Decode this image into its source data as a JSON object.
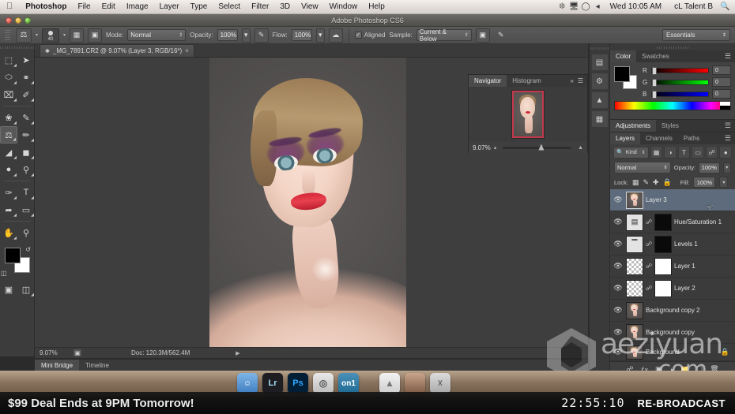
{
  "macbar": {
    "apple_icon": "apple-icon",
    "app_name": "Photoshop",
    "menus": [
      "File",
      "Edit",
      "Image",
      "Layer",
      "Type",
      "Select",
      "Filter",
      "3D",
      "View",
      "Window",
      "Help"
    ],
    "status_icons": [
      "bluetooth-icon",
      "display-icon",
      "wifi-icon",
      "volume-icon"
    ],
    "clock": "Wed 10:05 AM",
    "user": "cL Talent B",
    "search_icon": "search-icon"
  },
  "titlebar": {
    "title": "Adobe Photoshop CS6",
    "close": "close-button",
    "minimize": "minimize-button",
    "zoom": "zoom-button"
  },
  "options_bar": {
    "tool_icon": "clone-stamp-icon",
    "brush_size": "40",
    "brush_panel_icon": "brush-panel-icon",
    "clone_source_icon": "clone-source-icon",
    "mode_label": "Mode:",
    "mode_value": "Normal",
    "opacity_label": "Opacity:",
    "opacity_value": "100%",
    "pressure_opacity_icon": "pressure-opacity-icon",
    "flow_label": "Flow:",
    "flow_value": "100%",
    "airbrush_icon": "airbrush-icon",
    "aligned_label": "Aligned",
    "sample_label": "Sample:",
    "sample_value": "Current & Below",
    "ignore_adjustment_icon": "ignore-adjustment-layers-icon",
    "tablet_pressure_icon": "tablet-pressure-icon",
    "workspace": "Essentials"
  },
  "document": {
    "tab_title": "_MG_7891.CR2 @ 9.07% (Layer 3, RGB/16*)",
    "close_icon": "close-tab-icon",
    "status_zoom": "9.07%",
    "status_doc": "Doc: 120.3M/562.4M",
    "bottom_tabs": [
      {
        "label": "Mini Bridge",
        "active": true
      },
      {
        "label": "Timeline",
        "active": false
      }
    ]
  },
  "navigator": {
    "tabs": [
      {
        "label": "Navigator",
        "active": true
      },
      {
        "label": "Histogram",
        "active": false
      }
    ],
    "collapse_icon": "collapse-icon",
    "menu_icon": "panel-menu-icon",
    "zoom_value": "9.07%",
    "zoom_out_icon": "zoom-out-icon",
    "zoom_in_icon": "zoom-in-icon"
  },
  "icon_rail": [
    "history-icon",
    "actions-icon",
    "adjustments-icon",
    "properties-icon"
  ],
  "color_panel": {
    "tabs": [
      {
        "label": "Color",
        "active": true
      },
      {
        "label": "Swatches",
        "active": false
      }
    ],
    "menu_icon": "panel-menu-icon",
    "foreground": "#000000",
    "background": "#ffffff",
    "channels": [
      {
        "label": "R",
        "value": "0"
      },
      {
        "label": "G",
        "value": "0"
      },
      {
        "label": "B",
        "value": "0"
      }
    ]
  },
  "adjustments_panel": {
    "tabs": [
      {
        "label": "Adjustments",
        "active": true
      },
      {
        "label": "Styles",
        "active": false
      }
    ],
    "menu_icon": "panel-menu-icon"
  },
  "layers_panel": {
    "tabs": [
      {
        "label": "Layers",
        "active": true
      },
      {
        "label": "Channels",
        "active": false
      },
      {
        "label": "Paths",
        "active": false
      }
    ],
    "menu_icon": "panel-menu-icon",
    "filter_kind": "Kind",
    "filter_icons": [
      "filter-pixel-icon",
      "filter-adjustment-icon",
      "filter-type-icon",
      "filter-shape-icon",
      "filter-smart-icon",
      "filter-toggle-icon"
    ],
    "blend_mode": "Normal",
    "opacity_label": "Opacity:",
    "opacity_value": "100%",
    "lock_label": "Lock:",
    "lock_icons": [
      "lock-transparent-icon",
      "lock-image-icon",
      "lock-position-icon",
      "lock-all-icon"
    ],
    "fill_label": "Fill:",
    "fill_value": "100%",
    "layers": [
      {
        "name": "Layer 3",
        "type": "pixel",
        "thumb": "portrait",
        "selected": true,
        "visible": true,
        "mask": null
      },
      {
        "name": "Hue/Saturation 1",
        "type": "adjustment",
        "thumb": "hue-sat-icon",
        "selected": false,
        "visible": true,
        "mask": "black"
      },
      {
        "name": "Levels 1",
        "type": "adjustment",
        "thumb": "levels-icon",
        "selected": false,
        "visible": true,
        "mask": "black"
      },
      {
        "name": "Layer 1",
        "type": "pixel",
        "thumb": "checker",
        "selected": false,
        "visible": true,
        "mask": "white"
      },
      {
        "name": "Layer 2",
        "type": "pixel",
        "thumb": "checker",
        "selected": false,
        "visible": true,
        "mask": "white"
      },
      {
        "name": "Background copy 2",
        "type": "pixel",
        "thumb": "portrait",
        "selected": false,
        "visible": true,
        "mask": null
      },
      {
        "name": "Background copy",
        "type": "pixel",
        "thumb": "portrait",
        "selected": false,
        "visible": true,
        "mask": null
      },
      {
        "name": "Background",
        "type": "pixel",
        "thumb": "portrait",
        "selected": false,
        "visible": true,
        "mask": null
      }
    ],
    "footer_icons": [
      "link-layers-icon",
      "layer-style-icon",
      "add-mask-icon",
      "adjustment-layer-icon",
      "new-group-icon",
      "new-layer-icon",
      "delete-layer-icon"
    ]
  },
  "tools": [
    {
      "name": "marquee-tool",
      "glyph": "⬚",
      "selected": false
    },
    {
      "name": "move-tool",
      "glyph": "➤",
      "selected": false
    },
    {
      "name": "lasso-tool",
      "glyph": "⬭",
      "selected": false
    },
    {
      "name": "quick-selection-tool",
      "glyph": "✒",
      "selected": false
    },
    {
      "name": "crop-tool",
      "glyph": "⌗",
      "selected": false
    },
    {
      "name": "eyedropper-tool",
      "glyph": "✐",
      "selected": false
    },
    {
      "name": "spot-healing-tool",
      "glyph": "❀",
      "selected": false
    },
    {
      "name": "brush-tool",
      "glyph": "✒",
      "selected": false
    },
    {
      "name": "clone-stamp-tool",
      "glyph": "⚑",
      "selected": true
    },
    {
      "name": "history-brush-tool",
      "glyph": "✎",
      "selected": false
    },
    {
      "name": "eraser-tool",
      "glyph": "◢",
      "selected": false
    },
    {
      "name": "gradient-tool",
      "glyph": "▣",
      "selected": false
    },
    {
      "name": "blur-tool",
      "glyph": "●",
      "selected": false
    },
    {
      "name": "dodge-tool",
      "glyph": "⚲",
      "selected": false
    },
    {
      "name": "pen-tool",
      "glyph": "✑",
      "selected": false
    },
    {
      "name": "type-tool",
      "glyph": "T",
      "selected": false
    },
    {
      "name": "path-selection-tool",
      "glyph": "➦",
      "selected": false
    },
    {
      "name": "rectangle-tool",
      "glyph": "▭",
      "selected": false
    },
    {
      "name": "hand-tool",
      "glyph": "✋",
      "selected": false
    },
    {
      "name": "zoom-tool",
      "glyph": "⚲",
      "selected": false
    }
  ],
  "tool_extras": {
    "foreground_color": "#000000",
    "background_color": "#ffffff",
    "swap_icon": "swap-colors-icon",
    "default_icon": "default-colors-icon",
    "quickmask_icon": "quick-mask-icon",
    "screenmode_icon": "screen-mode-icon"
  },
  "dock": [
    {
      "name": "finder",
      "label": "☺"
    },
    {
      "name": "lightroom",
      "label": "Lr"
    },
    {
      "name": "photoshop",
      "label": "Ps"
    },
    {
      "name": "camera-app",
      "label": "◎"
    },
    {
      "name": "on1",
      "label": "on1"
    },
    {
      "name": "bag-app",
      "label": "▲"
    },
    {
      "name": "photo-app",
      "label": ""
    },
    {
      "name": "trash",
      "label": "☓"
    }
  ],
  "promo": {
    "headline": "$99 Deal Ends at 9PM Tomorrow!",
    "timer": "22:55:10",
    "badge": "RE-BROADCAST"
  },
  "watermark": {
    "text": "aeziyuan",
    "suffix": ".com",
    "logo": "cube-logo-icon"
  }
}
